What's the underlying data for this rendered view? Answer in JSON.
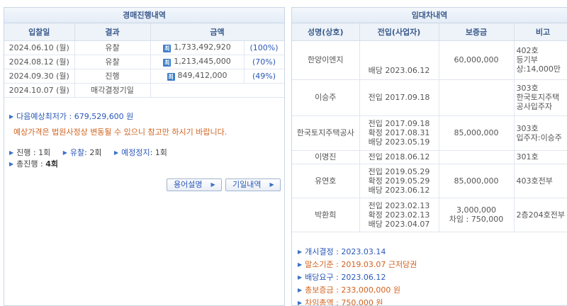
{
  "auction": {
    "title": "경매진행내역",
    "headers": [
      "입찰일",
      "결과",
      "금액"
    ],
    "rows": [
      {
        "date": "2024.06.10 (월)",
        "result": "유찰",
        "icon": "최",
        "amount": "1,733,492,920",
        "pct": "(100%)"
      },
      {
        "date": "2024.08.12 (월)",
        "result": "유찰",
        "icon": "최",
        "amount": "1,213,445,000",
        "pct": "(70%)"
      },
      {
        "date": "2024.09.30 (월)",
        "result": "진행",
        "icon": "최",
        "amount": "849,412,000",
        "pct": "(49%)"
      },
      {
        "date": "2024.10.07 (월)",
        "result": "매각결정기일",
        "icon": "",
        "amount": "",
        "pct": ""
      }
    ],
    "next_min_label": "다음예상최저가 : ",
    "next_min_value": "679,529,600 원",
    "notice": "예상가격은 법원사정상 변동될 수 있으니 참고만 하시기 바랍니다.",
    "stats": {
      "progress_label": "진행",
      "progress_value": ": 1회",
      "fail_label": "유찰",
      "fail_value": ": 2회",
      "stop_label": "예정정지",
      "stop_value": ": 1회",
      "total_label": "총진행 : ",
      "total_value": "4회"
    },
    "buttons": {
      "glossary": "용어설명",
      "history": "기일내역"
    }
  },
  "lease": {
    "title": "임대차내역",
    "headers": [
      "성명(상호)",
      "전입(사업자)",
      "보증금",
      "비고"
    ],
    "rows": [
      {
        "name": "한양이엔지",
        "move": [
          "",
          "배당 2023.06.12"
        ],
        "deposit": [
          "60,000,000"
        ],
        "note": [
          "402호",
          "등기부",
          "상:14,000만"
        ]
      },
      {
        "name": "이승주",
        "move": [
          "전입 2017.09.18"
        ],
        "deposit": [
          ""
        ],
        "note": [
          "303호",
          "한국토지주택",
          "공사입주자"
        ]
      },
      {
        "name": "한국토지주택공사",
        "move": [
          "전입 2017.09.18",
          "확정 2017.08.31",
          "배당 2023.05.19"
        ],
        "deposit": [
          "85,000,000"
        ],
        "note": [
          "303호",
          "입주자:이승주"
        ]
      },
      {
        "name": "이명진",
        "move": [
          "전입 2018.06.12"
        ],
        "deposit": [
          ""
        ],
        "note": [
          "301호"
        ]
      },
      {
        "name": "유연호",
        "move": [
          "전입 2019.05.29",
          "확정 2019.05.29",
          "배당 2023.06.12"
        ],
        "deposit": [
          "85,000,000"
        ],
        "note": [
          "403호전부"
        ]
      },
      {
        "name": "박환희",
        "move": [
          "전입 2023.02.13",
          "확정 2023.02.13",
          "배당 2023.04.07"
        ],
        "deposit": [
          "3,000,000",
          "차임 : 750,000"
        ],
        "note": [
          "2층204호전부"
        ]
      }
    ],
    "summary": {
      "start_label": "개시결정 : ",
      "start_value": "2023.03.14",
      "base_label": "말소기준 : ",
      "base_value": "2019.03.07 근저당권",
      "dist_label": "배당요구 : ",
      "dist_value": "2023.06.12",
      "deposit_label": "총보증금 : ",
      "deposit_value": "233,000,000 원",
      "rent_label": "차임총액 : ",
      "rent_value": "750,000 원"
    }
  },
  "colors": {
    "accent": "#2a58b8",
    "warning": "#d0621e",
    "header_bg": "#eef3f9",
    "border": "#c9d6e6"
  }
}
